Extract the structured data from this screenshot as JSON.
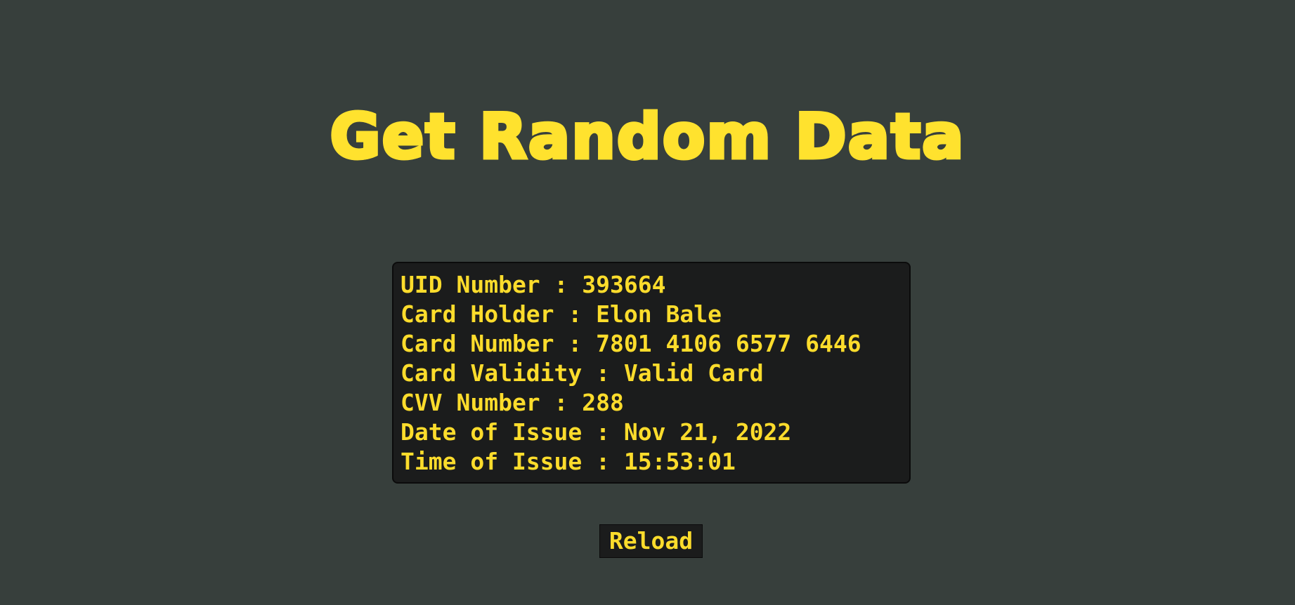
{
  "page": {
    "title": "Get Random Data"
  },
  "card": {
    "rows": [
      "UID Number : 393664",
      "Card Holder : Elon Bale",
      "Card Number : 7801 4106 6577 6446",
      "Card Validity : Valid Card",
      "CVV Number : 288",
      "Date of Issue : Nov 21, 2022",
      "Time of Issue : 15:53:01"
    ]
  },
  "actions": {
    "reload_label": "Reload"
  },
  "colors": {
    "background": "#373f3c",
    "accent": "#ffe22e",
    "card_background": "#1b1c1c"
  }
}
